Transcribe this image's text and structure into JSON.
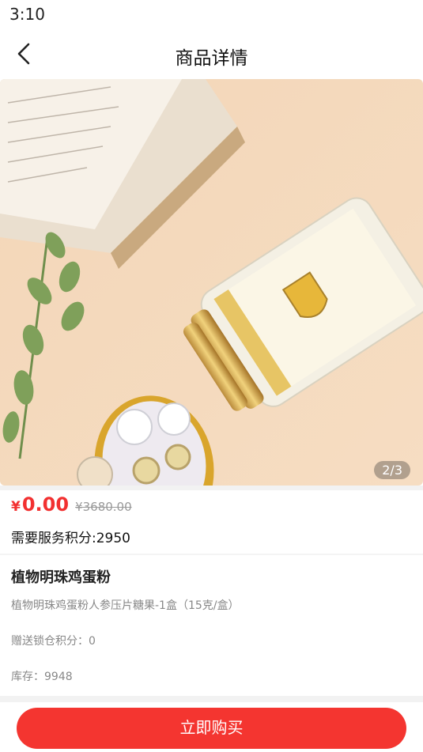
{
  "status_bar": {
    "time": "3:10"
  },
  "nav": {
    "title": "商品详情",
    "back_icon": "chevron-left-icon"
  },
  "gallery": {
    "indicator": "2/3"
  },
  "price": {
    "symbol": "¥",
    "value": "0.00",
    "original": "¥3680.00",
    "color": "#f23030"
  },
  "points": {
    "text": "需要服务积分:2950"
  },
  "product": {
    "name": "植物明珠鸡蛋粉",
    "description": "植物明珠鸡蛋粉人参压片糖果-1盒（15克/盒）",
    "bonus_points": "赠送锁仓积分：0",
    "stock": "库存：9948"
  },
  "actions": {
    "buy_label": "立即购买",
    "buy_color": "#f43530"
  }
}
